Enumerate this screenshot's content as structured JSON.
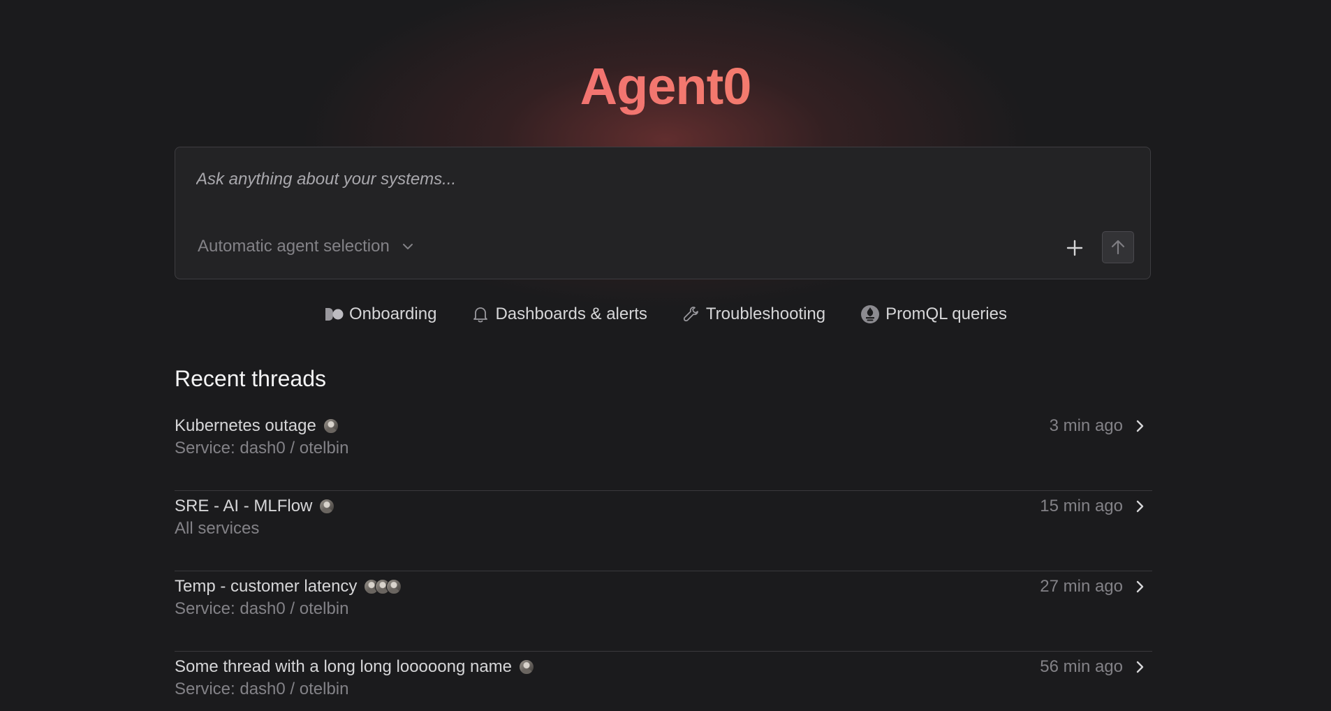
{
  "app": {
    "title": "Agent0"
  },
  "composer": {
    "placeholder": "Ask anything about your systems...",
    "agent_selection": "Automatic agent selection",
    "add_icon": "plus-icon",
    "send_icon": "arrow-up-icon"
  },
  "quick_links": [
    {
      "label": "Onboarding",
      "icon": "dash0-logo-icon"
    },
    {
      "label": "Dashboards & alerts",
      "icon": "bell-icon"
    },
    {
      "label": "Troubleshooting",
      "icon": "wrench-icon"
    },
    {
      "label": "PromQL queries",
      "icon": "prometheus-icon"
    }
  ],
  "recent_threads": {
    "title": "Recent threads",
    "items": [
      {
        "name": "Kubernetes outage",
        "scope": "Service: dash0 / otelbin",
        "time": "3 min ago",
        "avatars": 1
      },
      {
        "name": "SRE - AI - MLFlow",
        "scope": "All services",
        "time": "15 min ago",
        "avatars": 1
      },
      {
        "name": "Temp - customer latency",
        "scope": "Service: dash0 / otelbin",
        "time": "27 min ago",
        "avatars": 3
      },
      {
        "name": "Some thread with a long long looooong name",
        "scope": "Service: dash0 / otelbin",
        "time": "56 min ago",
        "avatars": 1
      }
    ]
  },
  "colors": {
    "background": "#1b1b1d",
    "title_gradient_start": "#f05a7a",
    "title_gradient_end": "#f79a6a",
    "panel": "#232325",
    "muted_text": "#838287"
  }
}
